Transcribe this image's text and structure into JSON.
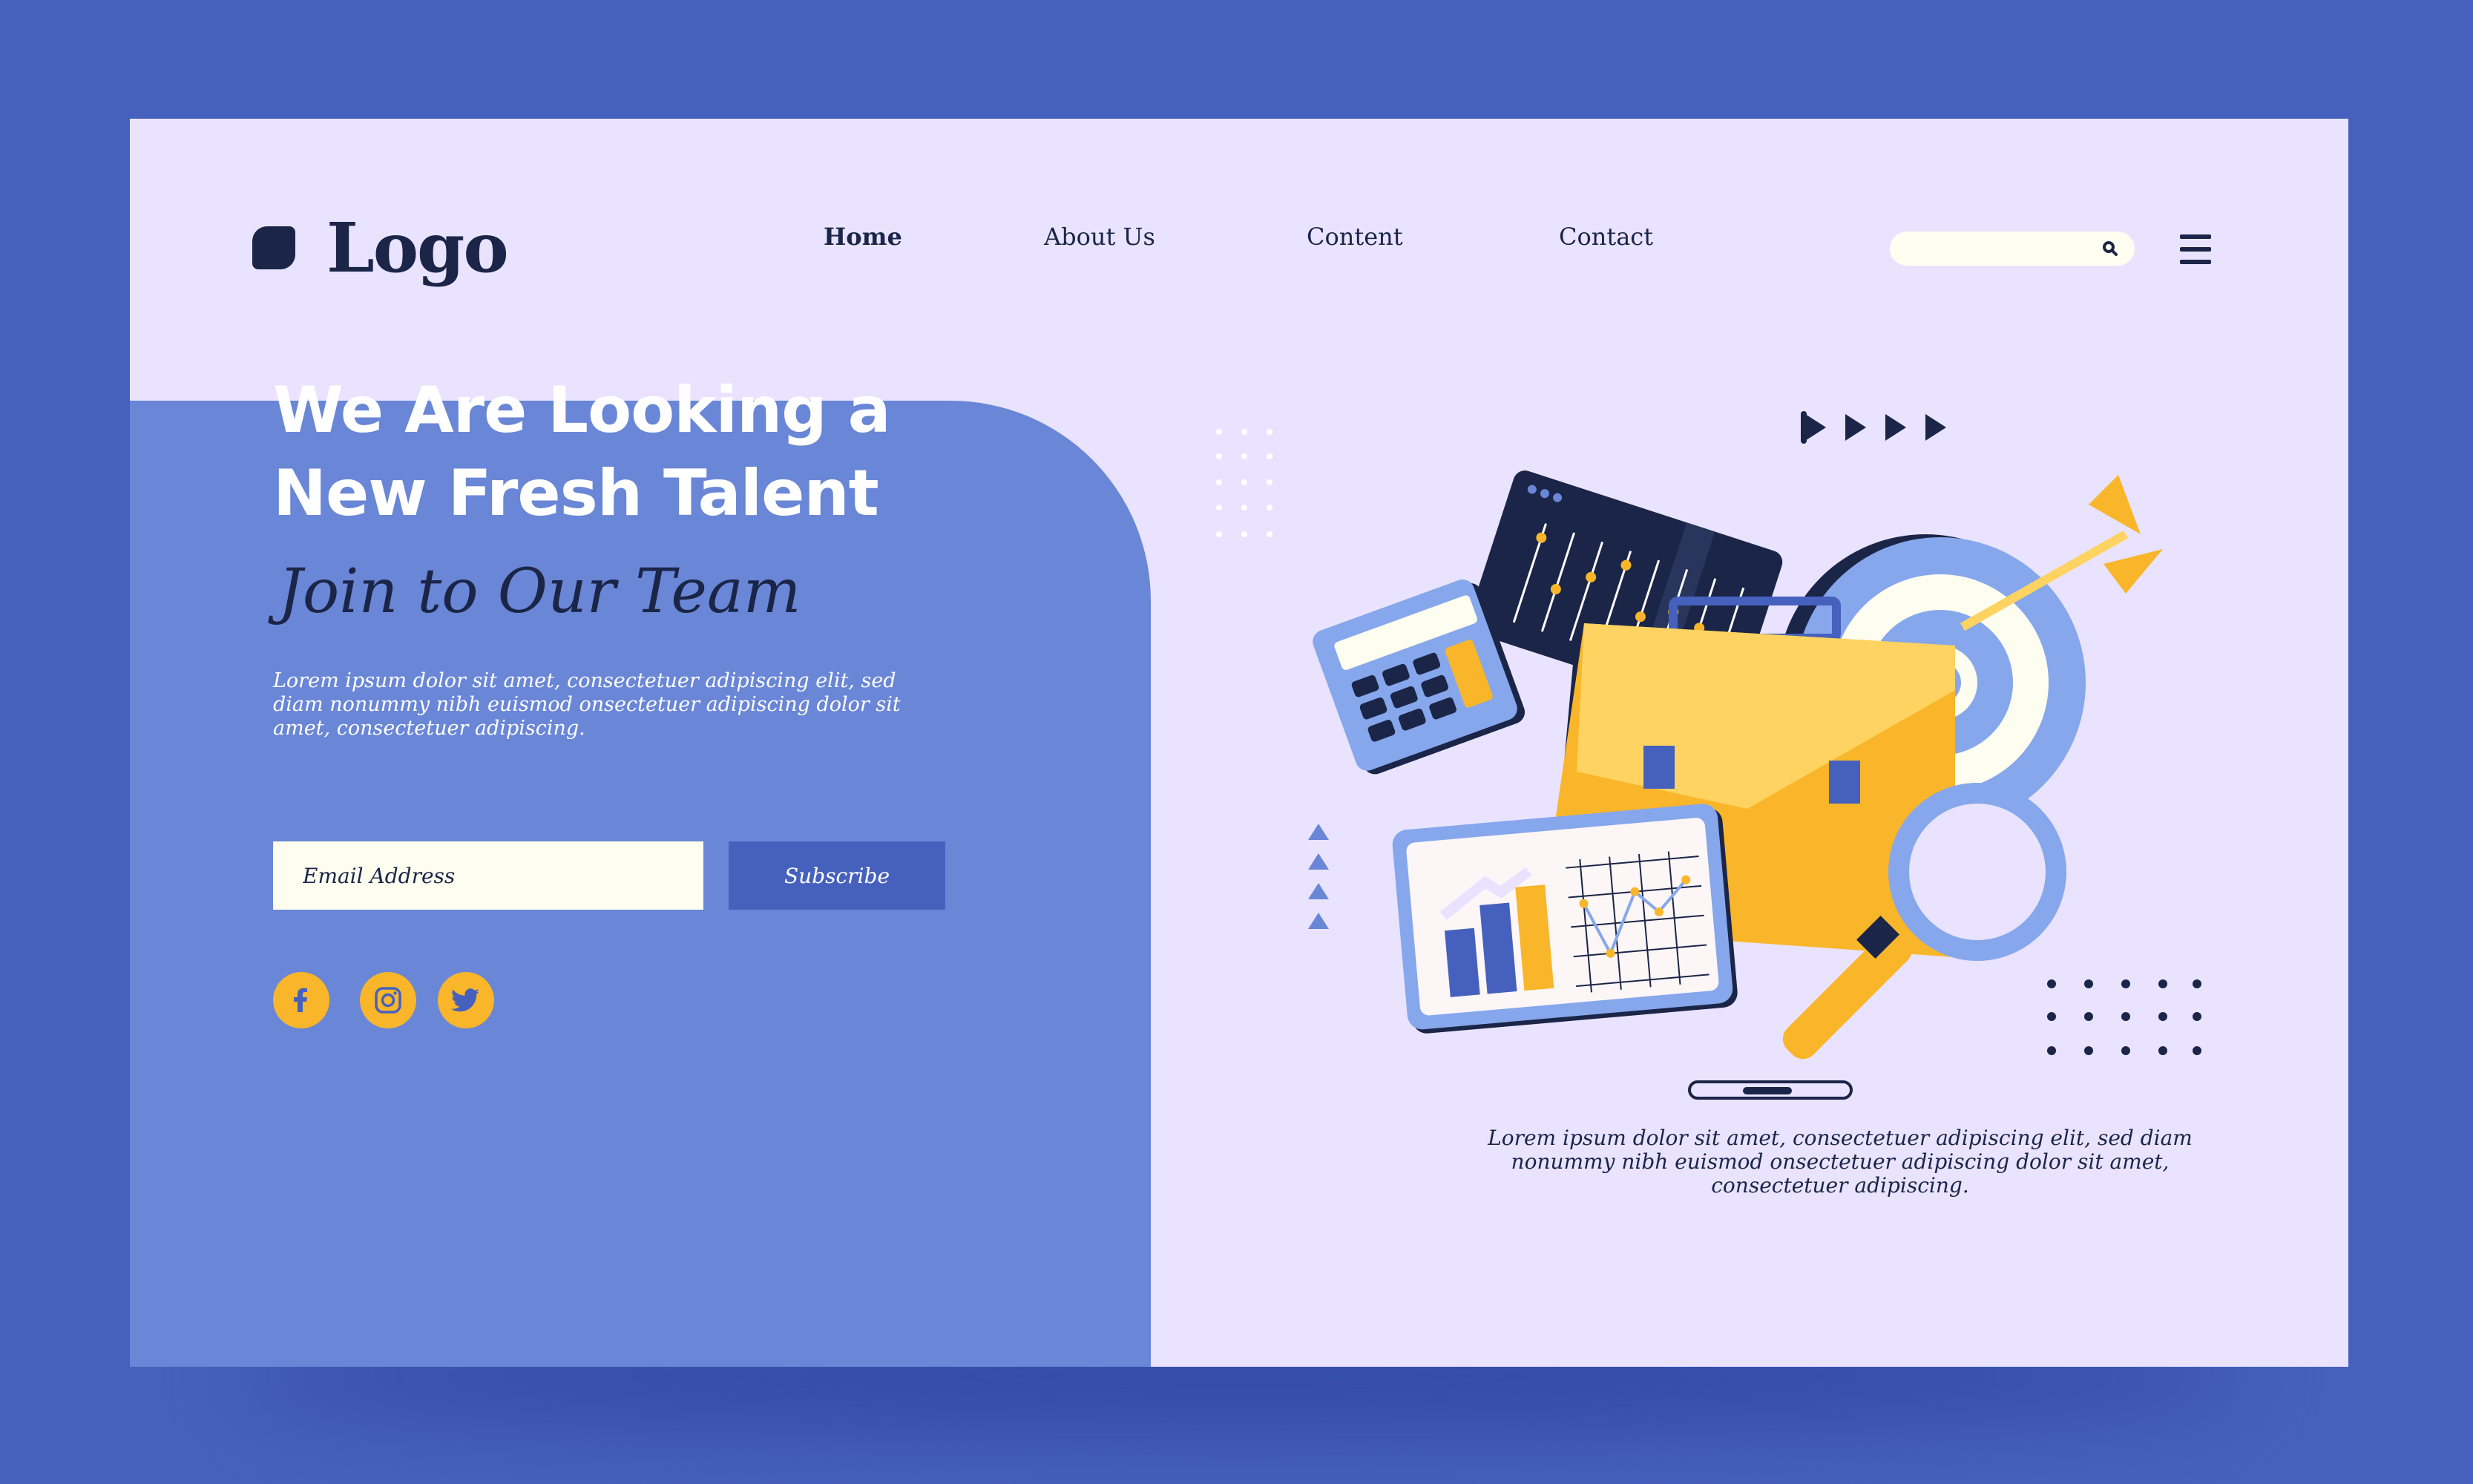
{
  "header": {
    "logo": "Logo",
    "nav": [
      {
        "label": "Home",
        "active": true
      },
      {
        "label": "About Us",
        "active": false
      },
      {
        "label": "Content",
        "active": false
      },
      {
        "label": "Contact",
        "active": false
      }
    ],
    "search": {
      "placeholder": ""
    },
    "menu_icon": "hamburger-menu-icon"
  },
  "hero": {
    "title_line1": "We Are Looking a",
    "title_line2": "New Fresh Talent",
    "subtitle": "Join to Our Team",
    "paragraph": "Lorem ipsum dolor sit amet, consectetuer adipiscing elit, sed diam nonummy nibh euismod onsectetuer adipiscing dolor sit amet, consectetuer adipiscing.",
    "email_placeholder": "Email Address",
    "subscribe_label": "Subscribe",
    "social": [
      "facebook-icon",
      "instagram-icon",
      "twitter-icon"
    ]
  },
  "right": {
    "paragraph": "Lorem ipsum dolor sit amet, consectetuer adipiscing elit, sed diam nonummy nibh euismod onsectetuer adipiscing dolor sit amet, consectetuer adipiscing."
  },
  "colors": {
    "background": "#4661bd",
    "page": "#e9e3ff",
    "hero_panel": "#6a86d6",
    "navy": "#1b2547",
    "yellow": "#f9b62a",
    "button": "#4661bd"
  }
}
